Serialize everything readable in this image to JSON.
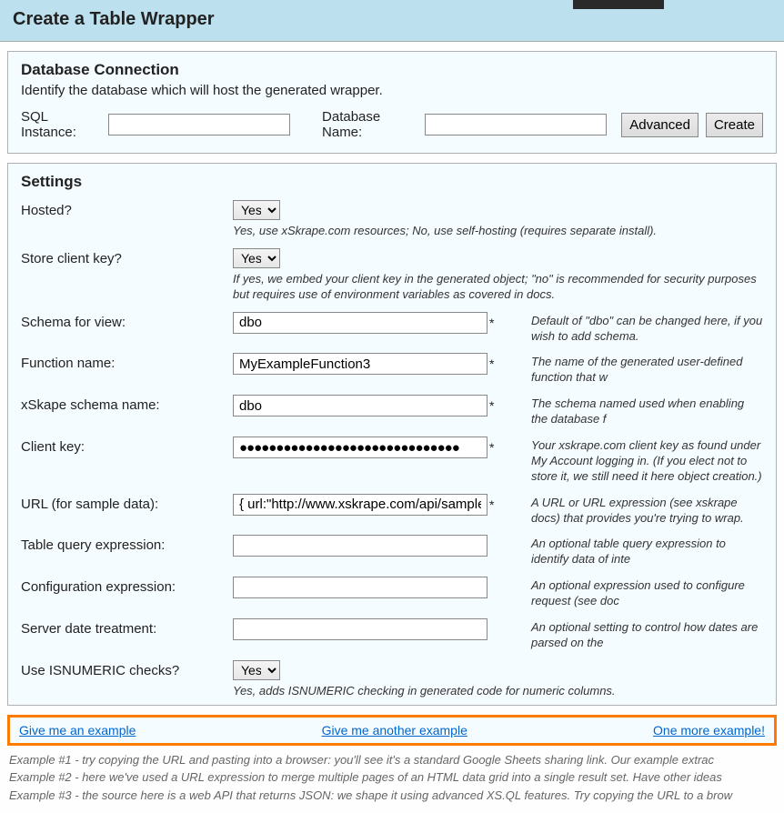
{
  "header": {
    "title": "Create a Table Wrapper"
  },
  "db": {
    "title": "Database Connection",
    "desc": "Identify the database which will host the generated wrapper.",
    "sql_label": "SQL Instance:",
    "sql_value": "",
    "dbname_label": "Database Name:",
    "dbname_value": "",
    "advanced": "Advanced",
    "create": "Create"
  },
  "settings": {
    "title": "Settings",
    "hosted_label": "Hosted?",
    "hosted_value": "Yes",
    "hosted_desc": "Yes, use xSkrape.com resources; No, use self-hosting (requires separate install).",
    "storekey_label": "Store client key?",
    "storekey_value": "Yes",
    "storekey_desc": "If yes, we embed your client key in the generated object; \"no\" is recommended for security purposes but requires use of environment variables as covered in docs.",
    "schemaview_label": "Schema for view:",
    "schemaview_value": "dbo",
    "schemaview_desc": "Default of \"dbo\" can be changed here, if you wish to add schema.",
    "funcname_label": "Function name:",
    "funcname_value": "MyExampleFunction3",
    "funcname_desc": "The name of the generated user-defined function that w",
    "xskape_label": "xSkape schema name:",
    "xskape_value": "dbo",
    "xskape_desc": "The schema named used when enabling the database f",
    "clientkey_label": "Client key:",
    "clientkey_value": "●●●●●●●●●●●●●●●●●●●●●●●●●●●●●●",
    "clientkey_desc": "Your xskrape.com client key as found under My Account logging in. (If you elect not to store it, we still need it here object creation.)",
    "url_label": "URL (for sample data):",
    "url_value": "{ url:\"http://www.xskrape.com/api/samplejs",
    "url_desc": "A URL or URL expression (see xskrape docs) that provides you're trying to wrap.",
    "tquery_label": "Table query expression:",
    "tquery_value": "",
    "tquery_desc": "An optional table query expression to identify data of inte",
    "config_label": "Configuration expression:",
    "config_value": "",
    "config_desc": "An optional expression used to configure request (see doc",
    "sdt_label": "Server date treatment:",
    "sdt_value": "",
    "sdt_desc": "An optional setting to control how dates are parsed on the",
    "isnum_label": "Use ISNUMERIC checks?",
    "isnum_value": "Yes",
    "isnum_desc": "Yes, adds ISNUMERIC checking in generated code for numeric columns."
  },
  "examples": {
    "link1": "Give me an example",
    "link2": "Give me another example",
    "link3": "One more example!"
  },
  "footnotes": {
    "l1": "Example #1 - try copying the URL and pasting into a browser: you'll see it's a standard Google Sheets sharing link. Our example extrac",
    "l2": "Example #2 - here we've used a URL expression to merge multiple pages of an HTML data grid into a single result set. Have other ideas",
    "l3": "Example #3 - the source here is a web API that returns JSON: we shape it using advanced XS.QL features. Try copying the URL to a brow"
  }
}
